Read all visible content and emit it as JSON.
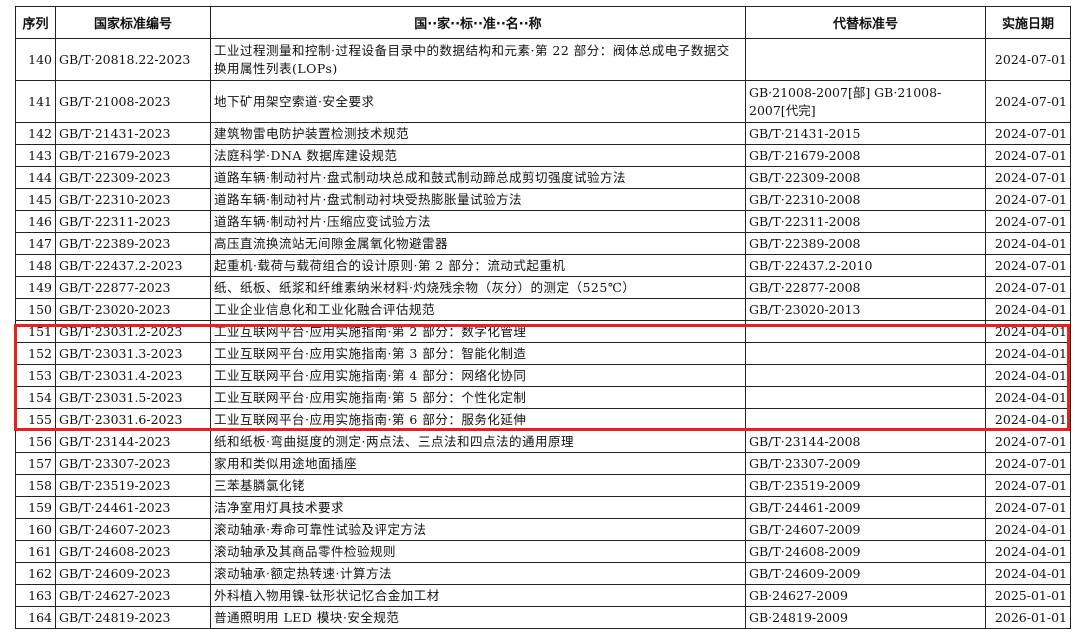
{
  "header": {
    "seq": "序列",
    "std_no": "国家标准编号",
    "name": "国··家··标··准··名··称",
    "replace": "代替标准号",
    "date": "实施日期"
  },
  "rows": [
    {
      "seq": "140",
      "no": "GB/T·20818.22-2023",
      "name": "工业过程测量和控制·过程设备目录中的数据结构和元素·第 22 部分：阀体总成电子数据交换用属性列表(LOPs)",
      "replace": "",
      "date": "2024-07-01"
    },
    {
      "seq": "141",
      "no": "GB/T·21008-2023",
      "name": "地下矿用架空索道·安全要求",
      "replace": "GB·21008-2007[部] GB·21008-2007[代完]",
      "date": "2024-07-01"
    },
    {
      "seq": "142",
      "no": "GB/T·21431-2023",
      "name": "建筑物雷电防护装置检测技术规范",
      "replace": "GB/T·21431-2015",
      "date": "2024-07-01"
    },
    {
      "seq": "143",
      "no": "GB/T·21679-2023",
      "name": "法庭科学·DNA 数据库建设规范",
      "replace": "GB/T·21679-2008",
      "date": "2024-07-01"
    },
    {
      "seq": "144",
      "no": "GB/T·22309-2023",
      "name": "道路车辆·制动衬片·盘式制动块总成和鼓式制动蹄总成剪切强度试验方法",
      "replace": "GB/T·22309-2008",
      "date": "2024-07-01"
    },
    {
      "seq": "145",
      "no": "GB/T·22310-2023",
      "name": "道路车辆·制动衬片·盘式制动衬块受热膨胀量试验方法",
      "replace": "GB/T·22310-2008",
      "date": "2024-07-01"
    },
    {
      "seq": "146",
      "no": "GB/T·22311-2023",
      "name": "道路车辆·制动衬片·压缩应变试验方法",
      "replace": "GB/T·22311-2008",
      "date": "2024-07-01"
    },
    {
      "seq": "147",
      "no": "GB/T·22389-2023",
      "name": "高压直流换流站无间隙金属氧化物避雷器",
      "replace": "GB/T·22389-2008",
      "date": "2024-04-01"
    },
    {
      "seq": "148",
      "no": "GB/T·22437.2-2023",
      "name": "起重机·载荷与载荷组合的设计原则·第 2 部分：流动式起重机",
      "replace": "GB/T·22437.2-2010",
      "date": "2024-07-01"
    },
    {
      "seq": "149",
      "no": "GB/T·22877-2023",
      "name": "纸、纸板、纸浆和纤维素纳米材料·灼烧残余物（灰分）的测定（525℃）",
      "replace": "GB/T·22877-2008",
      "date": "2024-07-01"
    },
    {
      "seq": "150",
      "no": "GB/T·23020-2023",
      "name": "工业企业信息化和工业化融合评估规范",
      "replace": "GB/T·23020-2013",
      "date": "2024-04-01"
    },
    {
      "seq": "151",
      "no": "GB/T·23031.2-2023",
      "name": "工业互联网平台·应用实施指南·第 2 部分：数字化管理",
      "replace": "",
      "date": "2024-04-01"
    },
    {
      "seq": "152",
      "no": "GB/T·23031.3-2023",
      "name": "工业互联网平台·应用实施指南·第 3 部分：智能化制造",
      "replace": "",
      "date": "2024-04-01"
    },
    {
      "seq": "153",
      "no": "GB/T·23031.4-2023",
      "name": "工业互联网平台·应用实施指南·第 4 部分：网络化协同",
      "replace": "",
      "date": "2024-04-01"
    },
    {
      "seq": "154",
      "no": "GB/T·23031.5-2023",
      "name": "工业互联网平台·应用实施指南·第 5 部分：个性化定制",
      "replace": "",
      "date": "2024-04-01"
    },
    {
      "seq": "155",
      "no": "GB/T·23031.6-2023",
      "name": "工业互联网平台·应用实施指南·第 6 部分：服务化延伸",
      "replace": "",
      "date": "2024-04-01"
    },
    {
      "seq": "156",
      "no": "GB/T·23144-2023",
      "name": "纸和纸板·弯曲挺度的测定·两点法、三点法和四点法的通用原理",
      "replace": "GB/T·23144-2008",
      "date": "2024-07-01"
    },
    {
      "seq": "157",
      "no": "GB/T·23307-2023",
      "name": "家用和类似用途地面插座",
      "replace": "GB/T·23307-2009",
      "date": "2024-07-01"
    },
    {
      "seq": "158",
      "no": "GB/T·23519-2023",
      "name": "三苯基膦氯化铑",
      "replace": "GB/T·23519-2009",
      "date": "2024-07-01"
    },
    {
      "seq": "159",
      "no": "GB/T·24461-2023",
      "name": "洁净室用灯具技术要求",
      "replace": "GB/T·24461-2009",
      "date": "2024-07-01"
    },
    {
      "seq": "160",
      "no": "GB/T·24607-2023",
      "name": "滚动轴承·寿命可靠性试验及评定方法",
      "replace": "GB/T·24607-2009",
      "date": "2024-04-01"
    },
    {
      "seq": "161",
      "no": "GB/T·24608-2023",
      "name": "滚动轴承及其商品零件检验规则",
      "replace": "GB/T·24608-2009",
      "date": "2024-04-01"
    },
    {
      "seq": "162",
      "no": "GB/T·24609-2023",
      "name": "滚动轴承·额定热转速·计算方法",
      "replace": "GB/T·24609-2009",
      "date": "2024-04-01"
    },
    {
      "seq": "163",
      "no": "GB/T·24627-2023",
      "name": "外科植入物用镍-钛形状记忆合金加工材",
      "replace": "GB·24627-2009",
      "date": "2025-01-01"
    },
    {
      "seq": "164",
      "no": "GB/T·24819-2023",
      "name": "普通照明用 LED 模块·安全规范",
      "replace": "GB·24819-2009",
      "date": "2026-01-01"
    }
  ],
  "highlight_color": "#e8211f"
}
